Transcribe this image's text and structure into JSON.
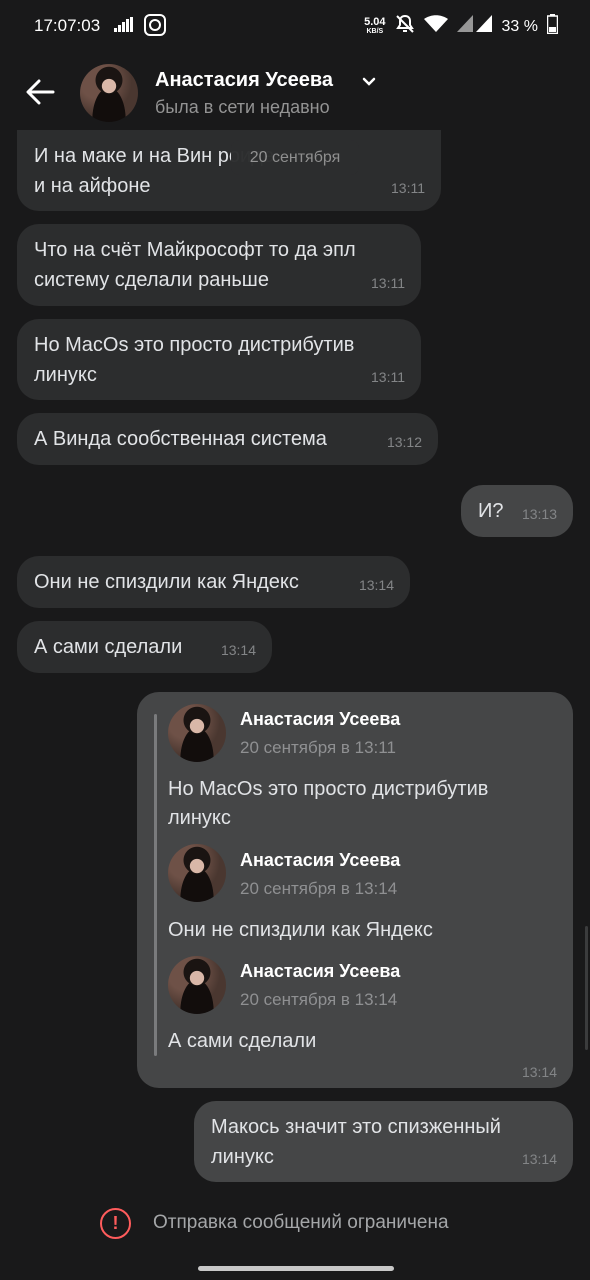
{
  "status_bar": {
    "time": "17:07:03",
    "net_speed": "5.04",
    "net_unit": "KB/S",
    "battery": "33 %",
    "icons": [
      "signal-bars-icon",
      "screen-record-icon",
      "mute-bell-icon",
      "wifi-icon",
      "cell-signal-icon",
      "battery-icon"
    ]
  },
  "header": {
    "name": "Анастасия Усеева",
    "status": "была в сети недавно"
  },
  "date_chip": "20 сентября",
  "messages": [
    {
      "direction": "in",
      "text": "И на маке и на Вин         роиде\nи на айфоне",
      "time": "13:11"
    },
    {
      "direction": "in",
      "text": "Что на счёт Майкрософт то да эпл\nсистему сделали раньше",
      "time": "13:11"
    },
    {
      "direction": "in",
      "text": "Но MacOs это просто дистрибутив\nлинукс",
      "time": "13:11"
    },
    {
      "direction": "in",
      "text": "А Винда сообственная система",
      "time": "13:12"
    },
    {
      "direction": "out",
      "text": "И?",
      "time": "13:13"
    },
    {
      "direction": "in",
      "text": "Они не спиздили как Яндекс",
      "time": "13:14"
    },
    {
      "direction": "in",
      "text": "А сами сделали",
      "time": "13:14"
    }
  ],
  "forwarded": {
    "time": "13:14",
    "items": [
      {
        "author": "Анастасия Усеева",
        "date": "20 сентября в 13:11",
        "text": "Но MacOs это просто дистрибутив\nлинукс"
      },
      {
        "author": "Анастасия Усеева",
        "date": "20 сентября в 13:14",
        "text": "Они не спиздили как Яндекс"
      },
      {
        "author": "Анастасия Усеева",
        "date": "20 сентября в 13:14",
        "text": "А сами сделали"
      }
    ]
  },
  "last_message": {
    "direction": "out",
    "text": "Макось значит это спизженный\nлинукс",
    "time": "13:14"
  },
  "restriction": {
    "text": "Отправка сообщений ограничена",
    "icon": "exclamation-circle-icon",
    "color": "#ff5c5c"
  },
  "colors": {
    "background": "#19191a",
    "incoming": "#2c2d2e",
    "outgoing": "#454647"
  }
}
